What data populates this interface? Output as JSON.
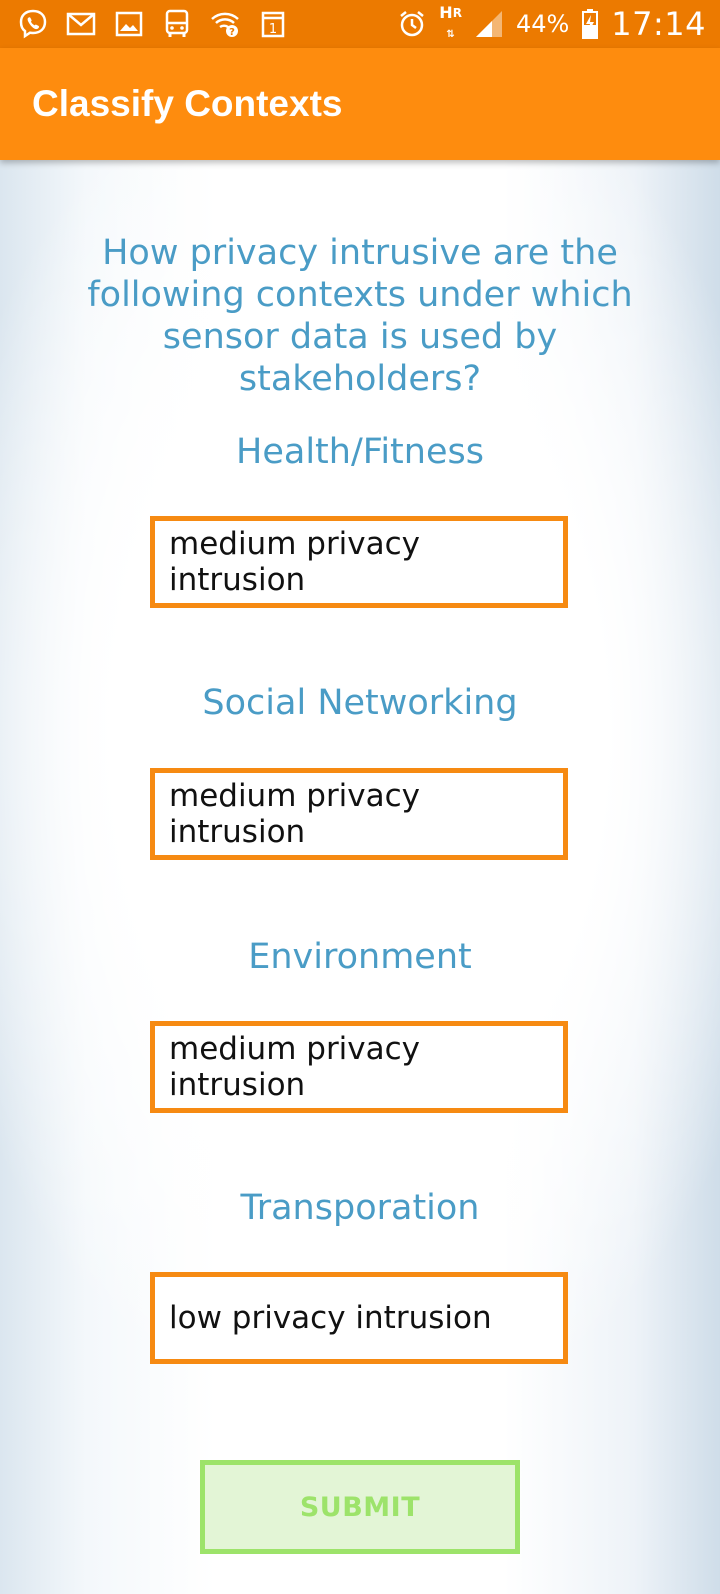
{
  "status_bar": {
    "icons_left": [
      "viber-icon",
      "gmail-icon",
      "gallery-icon",
      "bus-icon",
      "wifi-question-icon",
      "calendar-icon"
    ],
    "calendar_day": "1",
    "icons_right": [
      "alarm-icon",
      "network-type-icon",
      "signal-icon",
      "battery-icon"
    ],
    "network_letters": [
      "H",
      "R"
    ],
    "battery_percent": "44%",
    "time": "17:14",
    "background_color": "#ec7a00"
  },
  "app_bar": {
    "title": "Classify Contexts",
    "background_color": "#fe8c0e"
  },
  "question": "How privacy intrusive are the following contexts under which sensor data is used by stakeholders?",
  "contexts": [
    {
      "label": "Health/Fitness",
      "value": "medium privacy intrusion"
    },
    {
      "label": "Social Networking",
      "value": "medium privacy intrusion"
    },
    {
      "label": "Environment",
      "value": "medium privacy intrusion"
    },
    {
      "label": "Transporation",
      "value": "low privacy intrusion"
    }
  ],
  "submit_button": {
    "label": "SUBMIT",
    "enabled": false,
    "color": "#9de36a"
  },
  "accent_color": "#f68a12",
  "label_color": "#4a9cc6"
}
